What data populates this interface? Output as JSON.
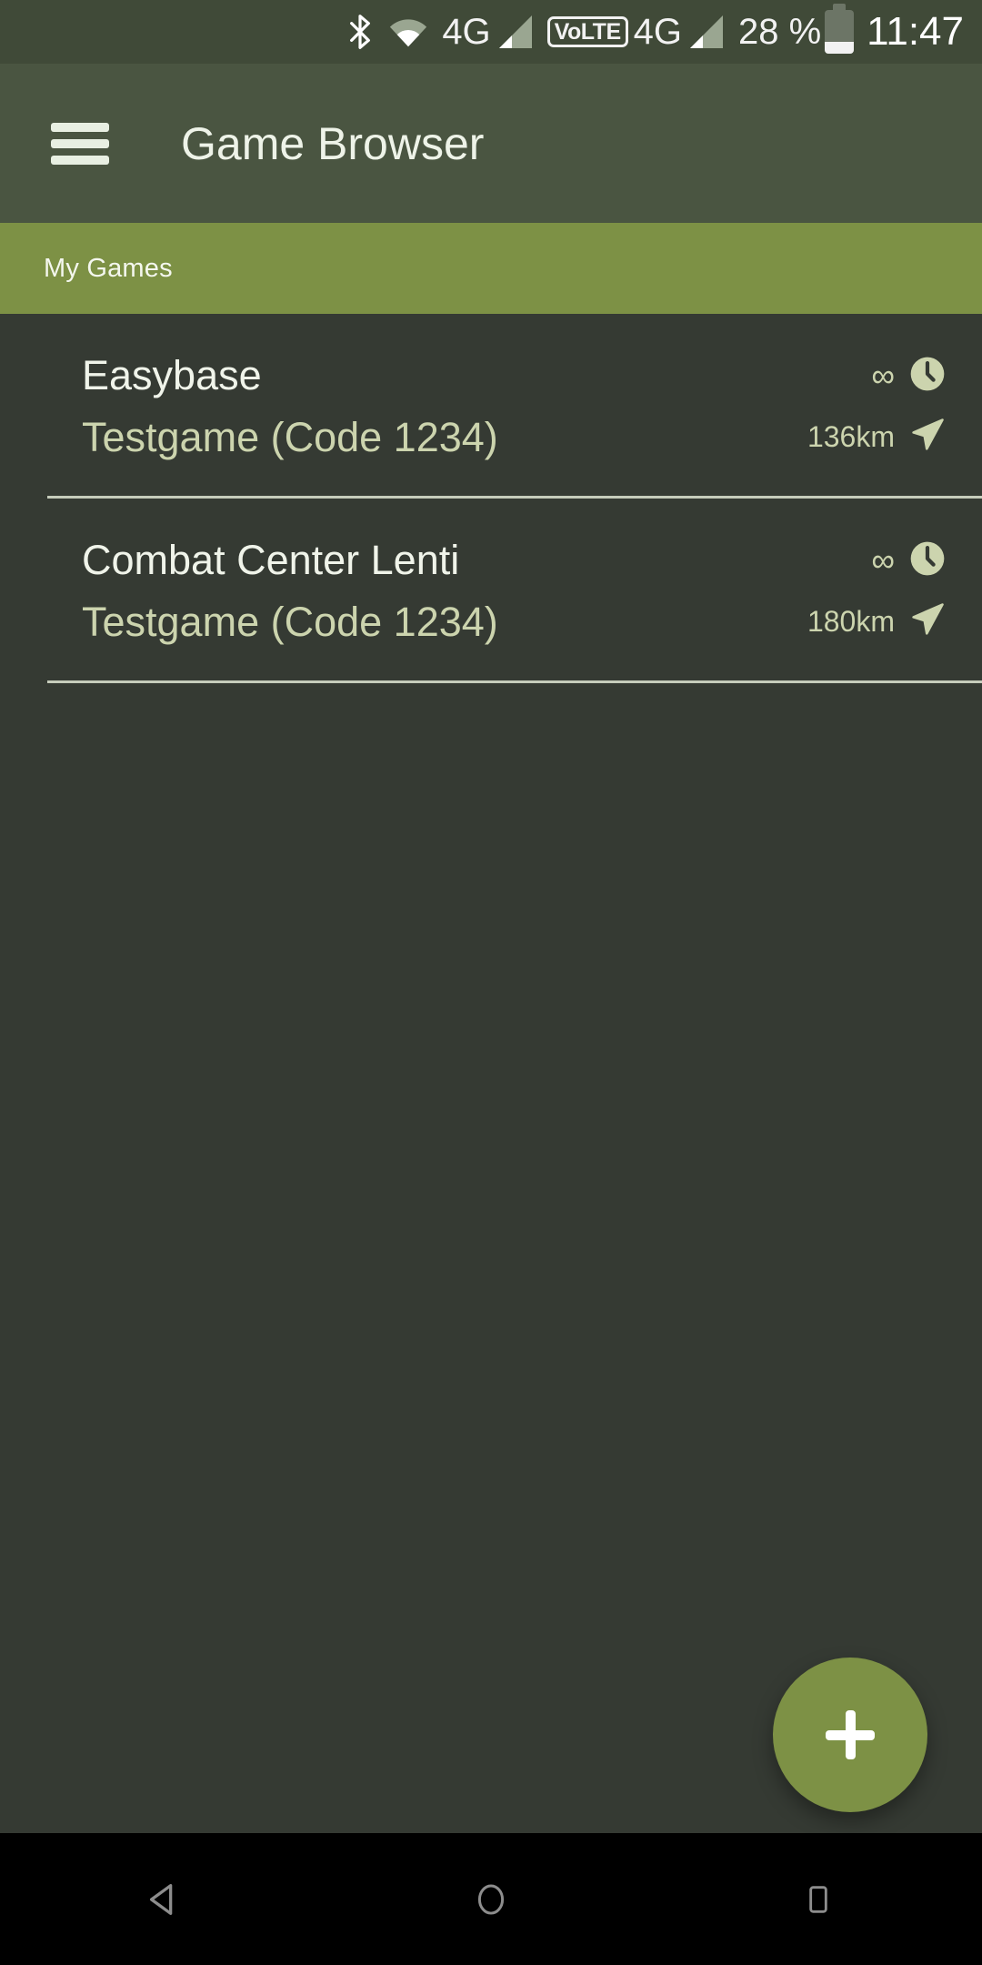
{
  "status_bar": {
    "icons": [
      "bluetooth-icon",
      "wifi-icon",
      "signal-icon",
      "volte-icon",
      "battery-icon"
    ],
    "network_label_1": "4G",
    "volte_label": "VoLTE",
    "network_label_2": "4G",
    "battery_percent": "28 %",
    "time": "11:47",
    "background": "#404a38"
  },
  "app_bar": {
    "menu_icon": "hamburger-menu-icon",
    "title": "Game Browser",
    "background": "#4a5541",
    "title_color": "#eef3e8"
  },
  "tabs": {
    "background": "#7d9145",
    "items": [
      {
        "label": "My Games",
        "selected": true
      }
    ]
  },
  "list": {
    "background": "#353a33",
    "items": [
      {
        "title": "Easybase",
        "subtitle": "Testgame (Code 1234)",
        "duration": "∞",
        "duration_icon": "clock-icon",
        "distance": "136km",
        "distance_icon": "navigation-arrow-icon"
      },
      {
        "title": "Combat Center Lenti",
        "subtitle": "Testgame (Code 1234)",
        "duration": "∞",
        "duration_icon": "clock-icon",
        "distance": "180km",
        "distance_icon": "navigation-arrow-icon"
      }
    ]
  },
  "fab": {
    "icon": "plus-icon",
    "label": "+",
    "color": "#7d9145"
  },
  "nav_bar": {
    "background": "#000000",
    "buttons": [
      {
        "name": "back-button",
        "icon": "back-triangle-icon"
      },
      {
        "name": "home-button",
        "icon": "home-circle-icon"
      },
      {
        "name": "recents-button",
        "icon": "recents-square-icon"
      }
    ]
  },
  "colors": {
    "accent": "#7d9145",
    "app_bar": "#4a5541",
    "status_bar": "#404a38",
    "content_bg": "#353a33",
    "primary_text": "#f0f4ea",
    "secondary_text": "#ccd4ae"
  }
}
